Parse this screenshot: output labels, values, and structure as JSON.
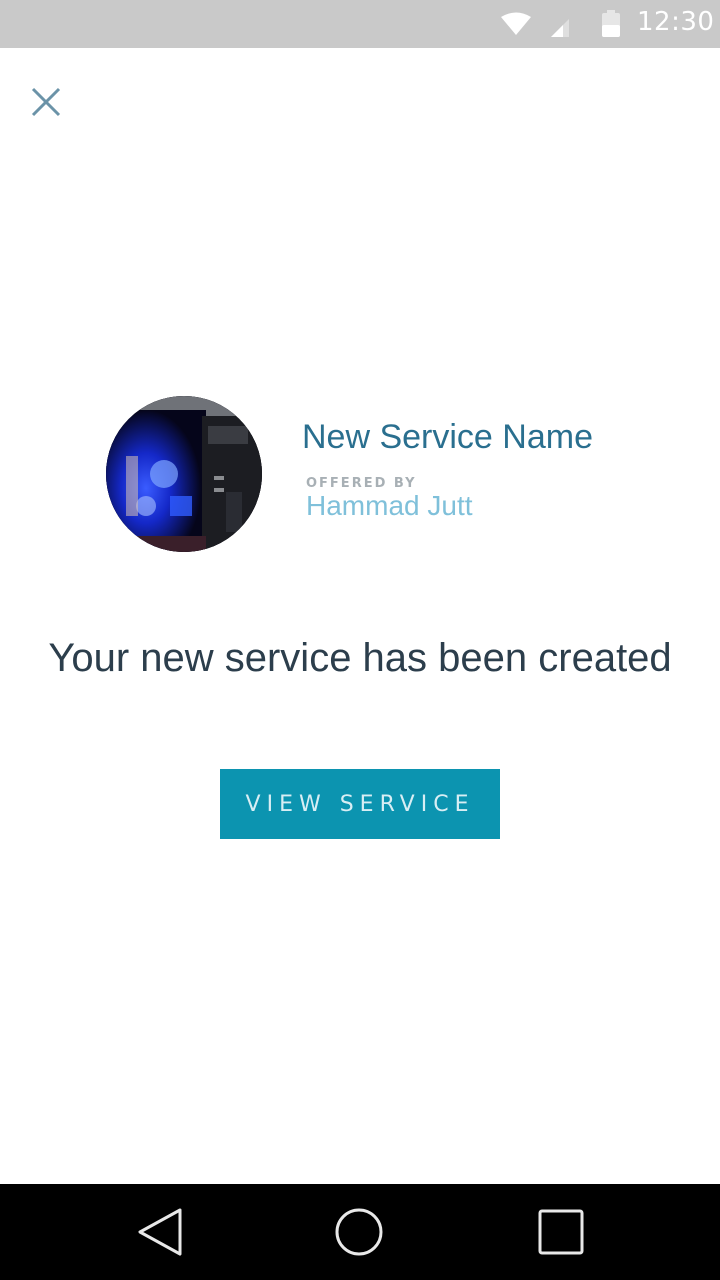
{
  "status_bar": {
    "time": "12:30",
    "icons": [
      "wifi-icon",
      "cell-signal-icon",
      "battery-icon"
    ]
  },
  "header": {
    "close_icon": "close-icon"
  },
  "service": {
    "name": "New Service Name",
    "offered_by_label": "OFFERED BY",
    "provider": "Hammad Jutt"
  },
  "message": "Your new service has been created",
  "actions": {
    "view_service_label": "VIEW SERVICE"
  },
  "nav_bar": {
    "icons": [
      "back-icon",
      "home-icon",
      "recents-icon"
    ]
  },
  "colors": {
    "accent": "#0c94b0",
    "service_name": "#2a6f8f",
    "provider": "#7fc0da",
    "status_bar": "#c9c9c9"
  }
}
